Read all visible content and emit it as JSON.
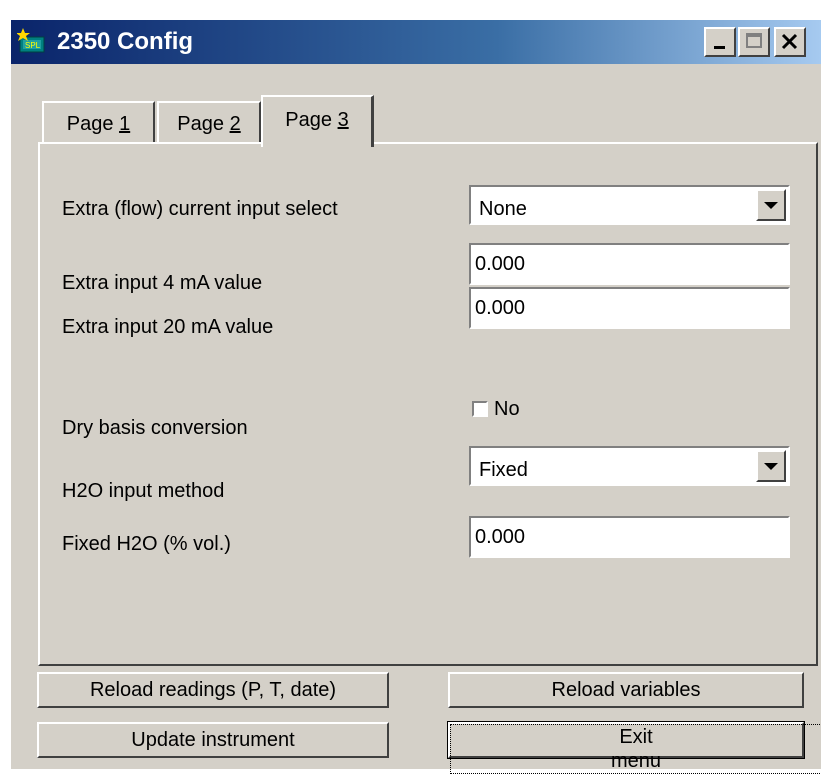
{
  "window": {
    "title": "2350 Config",
    "app_icon": "instrument-app-icon"
  },
  "title_buttons": [
    "minimize-icon",
    "maximize-icon",
    "close-icon"
  ],
  "tabs": [
    {
      "label_prefix": "Page ",
      "mnemonic": "1",
      "active": false
    },
    {
      "label_prefix": "Page ",
      "mnemonic": "2",
      "active": false
    },
    {
      "label_prefix": "Page ",
      "mnemonic": "3",
      "active": true
    }
  ],
  "form": {
    "extra_flow_label": "Extra (flow) current input select",
    "extra_flow_value": "None",
    "extra_4ma_label": "Extra input 4 mA value",
    "extra_4ma_value": "0.000",
    "extra_20ma_label": "Extra input 20 mA value",
    "extra_20ma_value": "0.000",
    "dry_basis_label": "Dry basis conversion",
    "dry_basis_checked": false,
    "dry_basis_text": "No",
    "h2o_method_label": "H2O input method",
    "h2o_method_value": "Fixed",
    "fixed_h2o_label": "Fixed H2O (% vol.)",
    "fixed_h2o_value": "0.000"
  },
  "buttons": {
    "reload_readings": "Reload readings (P, T, date)",
    "reload_variables": "Reload variables",
    "update_instrument": "Update instrument",
    "exit_menu": "Exit menu"
  }
}
